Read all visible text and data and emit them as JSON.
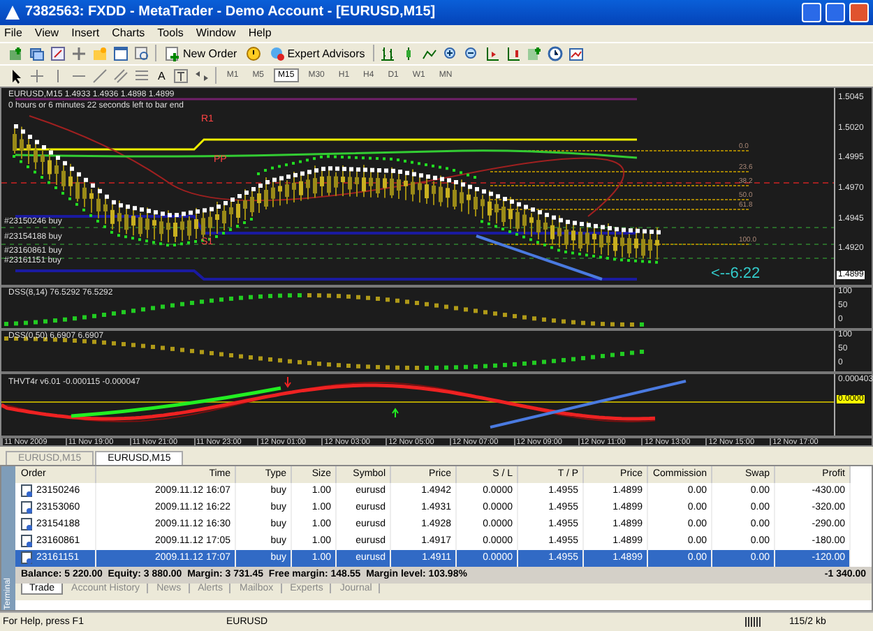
{
  "window": {
    "title": "7382563: FXDD - MetaTrader - Demo Account - [EURUSD,M15]"
  },
  "menu": [
    "File",
    "View",
    "Insert",
    "Charts",
    "Tools",
    "Window",
    "Help"
  ],
  "toolbar": {
    "new_order": "New Order",
    "expert_advisors": "Expert Advisors",
    "text_tool": "A",
    "timeframes": [
      {
        "label": "M1",
        "selected": false
      },
      {
        "label": "M5",
        "selected": false
      },
      {
        "label": "M15",
        "selected": true
      },
      {
        "label": "M30",
        "selected": false
      },
      {
        "label": "H1",
        "selected": false
      },
      {
        "label": "H4",
        "selected": false
      },
      {
        "label": "D1",
        "selected": false
      },
      {
        "label": "W1",
        "selected": false
      },
      {
        "label": "MN",
        "selected": false
      }
    ]
  },
  "chart": {
    "header": "EURUSD,M15  1.4933 1.4936 1.4898 1.4899",
    "countdown": "0 hours or 6 minutes 22 seconds left to bar end",
    "order_labels": [
      "#23150246 buy",
      "#23154188 buy",
      "#23160861 buy",
      "#23161151 buy"
    ],
    "pivot_labels": [
      "R1",
      "PP",
      "S1"
    ],
    "fib_labels": [
      "0.0",
      "23.6",
      "38.2",
      "50.0",
      "61.8",
      "100.0"
    ],
    "timer": "<--6:22",
    "price_axis": [
      "1.5045",
      "1.5020",
      "1.4995",
      "1.4970",
      "1.4945",
      "1.4920"
    ],
    "current_price": "1.4899",
    "indicators": [
      {
        "label": "DSS(8,14) 76.5292 76.5292",
        "axis": [
          "100",
          "50",
          "0"
        ]
      },
      {
        "label": "DSS(0,50) 6.6907 6.6907",
        "axis": [
          "100",
          "50",
          "0"
        ]
      },
      {
        "label": "THVT4r v6.01 -0.000115 -0.000047",
        "axis": [
          "0.000403"
        ],
        "zero_label": "0.0000"
      }
    ],
    "time_axis": [
      "11 Nov 2009",
      "11 Nov 19:00",
      "11 Nov 21:00",
      "11 Nov 23:00",
      "12 Nov 01:00",
      "12 Nov 03:00",
      "12 Nov 05:00",
      "12 Nov 07:00",
      "12 Nov 09:00",
      "12 Nov 11:00",
      "12 Nov 13:00",
      "12 Nov 15:00",
      "12 Nov 17:00"
    ]
  },
  "chart_tabs": [
    {
      "label": "EURUSD,M15",
      "selected": false
    },
    {
      "label": "EURUSD,M15",
      "selected": true
    }
  ],
  "terminal": {
    "side_label": "Terminal",
    "columns": [
      "Order",
      "Time",
      "Type",
      "Size",
      "Symbol",
      "Price",
      "S / L",
      "T / P",
      "Price",
      "Commission",
      "Swap",
      "Profit"
    ],
    "rows": [
      {
        "cells": [
          "23150246",
          "2009.11.12 16:07",
          "buy",
          "1.00",
          "eurusd",
          "1.4942",
          "0.0000",
          "1.4955",
          "1.4899",
          "0.00",
          "0.00",
          "-430.00"
        ],
        "selected": false
      },
      {
        "cells": [
          "23153060",
          "2009.11.12 16:22",
          "buy",
          "1.00",
          "eurusd",
          "1.4931",
          "0.0000",
          "1.4955",
          "1.4899",
          "0.00",
          "0.00",
          "-320.00"
        ],
        "selected": false
      },
      {
        "cells": [
          "23154188",
          "2009.11.12 16:30",
          "buy",
          "1.00",
          "eurusd",
          "1.4928",
          "0.0000",
          "1.4955",
          "1.4899",
          "0.00",
          "0.00",
          "-290.00"
        ],
        "selected": false
      },
      {
        "cells": [
          "23160861",
          "2009.11.12 17:05",
          "buy",
          "1.00",
          "eurusd",
          "1.4917",
          "0.0000",
          "1.4955",
          "1.4899",
          "0.00",
          "0.00",
          "-180.00"
        ],
        "selected": false
      },
      {
        "cells": [
          "23161151",
          "2009.11.12 17:07",
          "buy",
          "1.00",
          "eurusd",
          "1.4911",
          "0.0000",
          "1.4955",
          "1.4899",
          "0.00",
          "0.00",
          "-120.00"
        ],
        "selected": true
      }
    ],
    "summary": "Balance: 5 220.00  Equity: 3 880.00  Margin: 3 731.45  Free margin: 148.55  Margin level: 103.98%",
    "summary_profit": "-1 340.00",
    "tabs": [
      {
        "label": "Trade",
        "selected": true
      },
      {
        "label": "Account History",
        "selected": false
      },
      {
        "label": "News",
        "selected": false
      },
      {
        "label": "Alerts",
        "selected": false
      },
      {
        "label": "Mailbox",
        "selected": false
      },
      {
        "label": "Experts",
        "selected": false
      },
      {
        "label": "Journal",
        "selected": false
      }
    ]
  },
  "status_bar": [
    "For Help, press F1",
    "EURUSD",
    "115/2 kb"
  ]
}
